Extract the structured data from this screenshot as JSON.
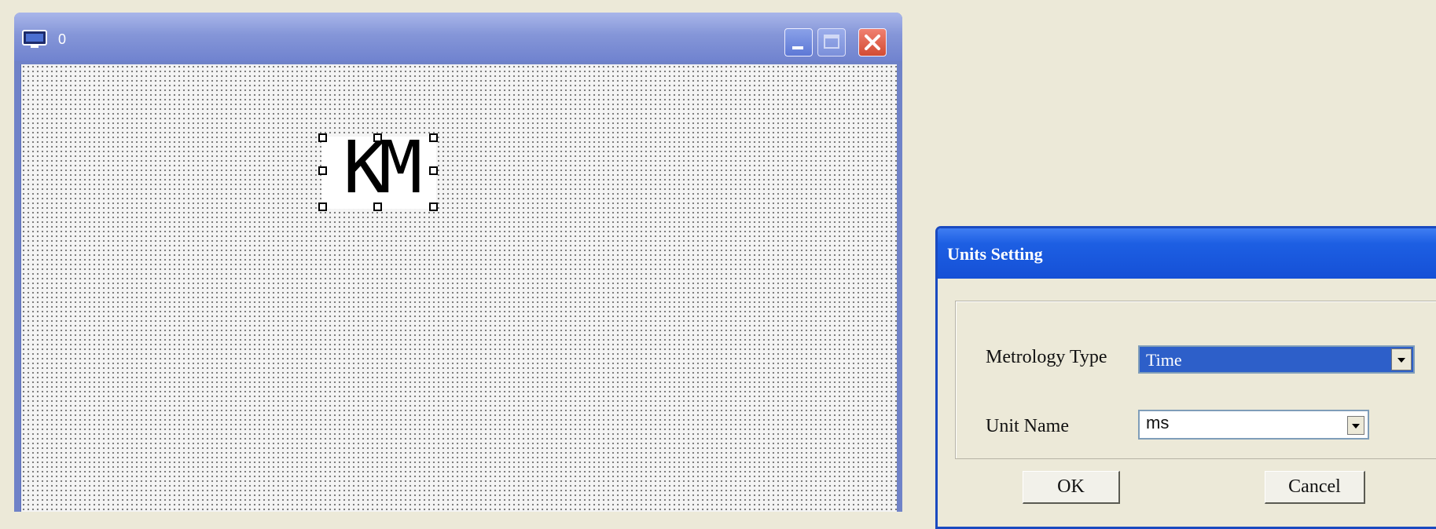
{
  "editor": {
    "title": "0",
    "object_text": "KM",
    "icons": [
      "screen-icon",
      "minimize-icon",
      "maximize-icon",
      "close-icon"
    ]
  },
  "dialog": {
    "title": "Units Setting",
    "metrology_type_label": "Metrology Type",
    "metrology_type_value": "Time",
    "unit_name_label": "Unit Name",
    "unit_name_value": "ms",
    "ok_label": "OK",
    "cancel_label": "Cancel"
  },
  "colors": {
    "editor_titlebar": "#8596d8",
    "dialog_titlebar": "#1d5fe3",
    "selected_field": "#2d5fc9",
    "close_button": "#d24c33",
    "desktop": "#ece9d8"
  }
}
